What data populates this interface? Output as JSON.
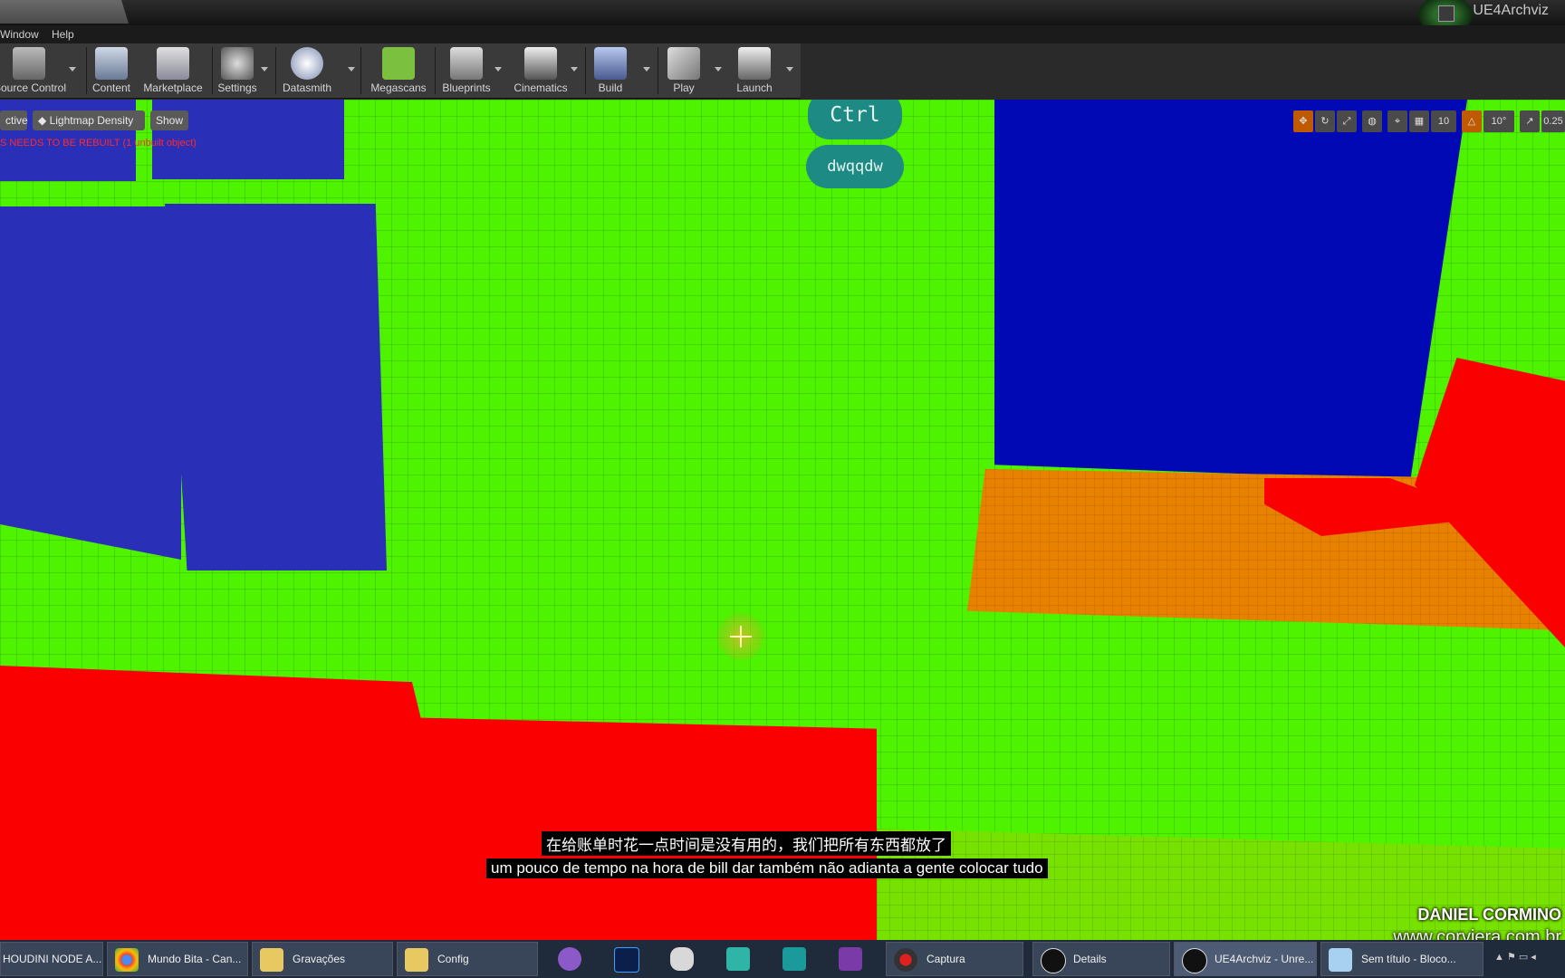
{
  "window": {
    "project_name": "UE4Archviz"
  },
  "menu": {
    "items": [
      "Window",
      "Help"
    ]
  },
  "toolbar": {
    "buttons": [
      {
        "label": "Source Control",
        "icon": "source-control-icon"
      },
      {
        "label": "Content",
        "icon": "content-icon"
      },
      {
        "label": "Marketplace",
        "icon": "marketplace-icon"
      },
      {
        "label": "Settings",
        "icon": "settings-icon"
      },
      {
        "label": "Datasmith",
        "icon": "datasmith-icon"
      },
      {
        "label": "Megascans",
        "icon": "megascans-icon"
      },
      {
        "label": "Blueprints",
        "icon": "blueprints-icon"
      },
      {
        "label": "Cinematics",
        "icon": "cinematics-icon"
      },
      {
        "label": "Build",
        "icon": "build-icon"
      },
      {
        "label": "Play",
        "icon": "play-icon"
      },
      {
        "label": "Launch",
        "icon": "launch-icon"
      }
    ]
  },
  "viewport": {
    "perspective_label": "ctive",
    "view_mode_label": "Lightmap Density",
    "show_label": "Show",
    "warning": "S NEEDS TO BE REBUILT (1 unbuilt object)",
    "grid_snap_value": "10",
    "rotation_snap_value": "10°",
    "scale_snap_value": "0.25",
    "colors": {
      "good_density": "#4ff300",
      "high_density": "#fb0000",
      "low_density": "#0009b4",
      "medium_density": "#e88000"
    }
  },
  "keys": {
    "key1": "Ctrl",
    "key2": "dwqqdw"
  },
  "subtitles": {
    "line1": "在给账单时花一点时间是没有用的，我们把所有东西都放了",
    "line2": "um pouco de tempo na hora de bill dar também não adianta a gente colocar tudo"
  },
  "watermark": {
    "author": "DANIEL CORMINO",
    "site": "www.corviera.com.br"
  },
  "taskbar": {
    "items": [
      {
        "label": "HOUDINI NODE A...",
        "icon": "houdini-icon"
      },
      {
        "label": "Mundo Bita - Can...",
        "icon": "chrome-icon"
      },
      {
        "label": "Gravações",
        "icon": "folder-icon"
      },
      {
        "label": "Config",
        "icon": "folder-icon"
      },
      {
        "label": "",
        "icon": "cat-app-icon"
      },
      {
        "label": "",
        "icon": "photoshop-icon"
      },
      {
        "label": "",
        "icon": "gamepad-icon"
      },
      {
        "label": "",
        "icon": "maya-icon"
      },
      {
        "label": "",
        "icon": "3dsmax-icon"
      },
      {
        "label": "",
        "icon": "app-icon"
      },
      {
        "label": "Captura",
        "icon": "record-icon"
      },
      {
        "label": "Details",
        "icon": "unreal-icon"
      },
      {
        "label": "UE4Archviz - Unre...",
        "icon": "unreal-icon"
      },
      {
        "label": "Sem título - Bloco...",
        "icon": "notepad-icon"
      }
    ]
  }
}
